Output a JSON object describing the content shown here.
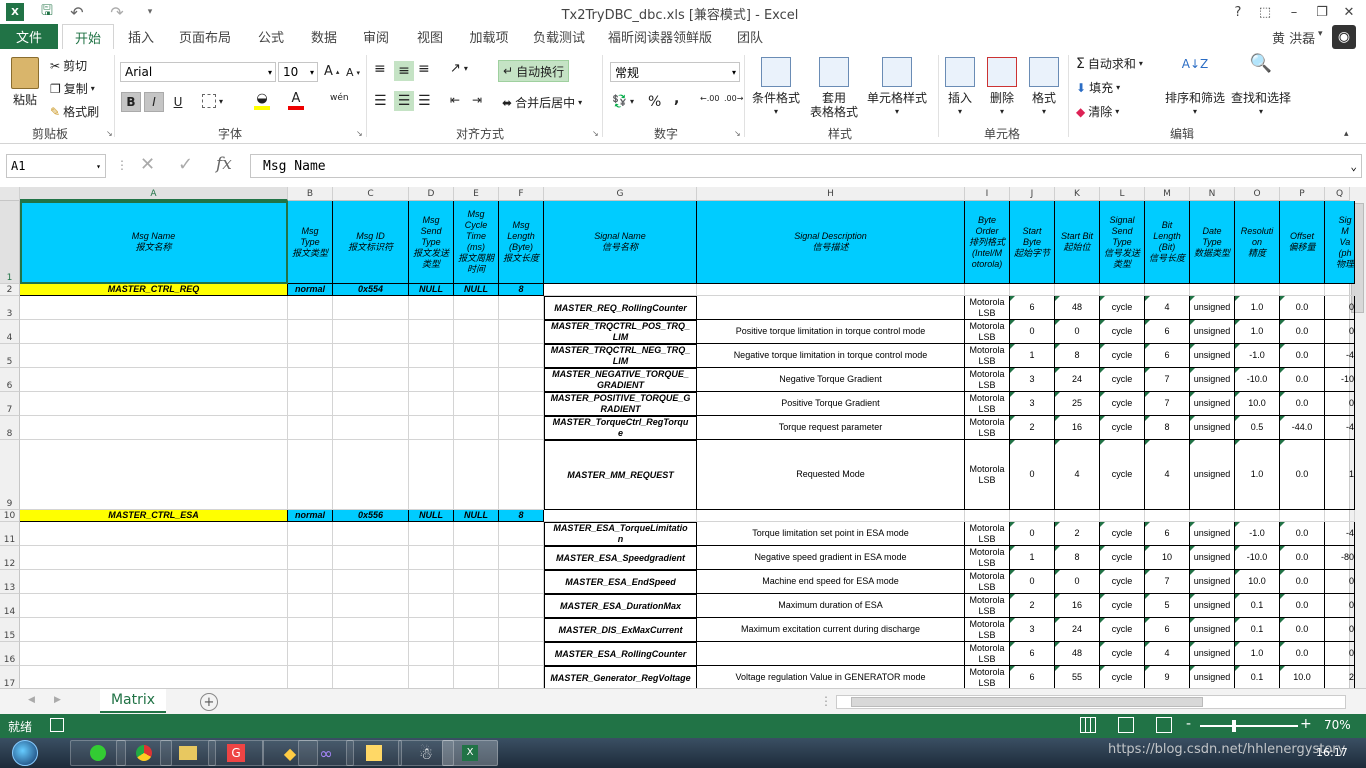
{
  "window": {
    "title": "Tx2TryDBC_dbc.xls  [兼容模式] - Excel",
    "help_label": "?",
    "user": "黄 洪磊"
  },
  "tabs": [
    "文件",
    "开始",
    "插入",
    "页面布局",
    "公式",
    "数据",
    "审阅",
    "视图",
    "加载项",
    "负载测试",
    "福昕阅读器领鲜版",
    "团队"
  ],
  "ribbon": {
    "clipboard": {
      "paste": "粘贴",
      "cut": "剪切",
      "copy": "复制",
      "format_painter": "格式刷",
      "label": "剪贴板"
    },
    "font": {
      "name": "Arial",
      "size": "10",
      "bold": "B",
      "italic": "I",
      "underline": "U",
      "wen": "wén",
      "label": "字体"
    },
    "alignment": {
      "wrap": "自动换行",
      "merge": "合并后居中",
      "label": "对齐方式"
    },
    "number": {
      "format": "常规",
      "percent": "%",
      "comma": ",",
      "label": "数字"
    },
    "styles": {
      "conditional": "条件格式",
      "table_format": "套用\n表格格式",
      "cell_styles": "单元格样式",
      "label": "样式"
    },
    "cells": {
      "insert": "插入",
      "delete": "删除",
      "format": "格式",
      "label": "单元格"
    },
    "editing": {
      "autosum": "自动求和",
      "fill": "填充",
      "clear": "清除",
      "sort": "排序和筛选",
      "find": "查找和选择",
      "label": "编辑"
    }
  },
  "formula_bar": {
    "name_box": "A1",
    "fx": "fx",
    "content": "Msg Name"
  },
  "columns": [
    "A",
    "B",
    "C",
    "D",
    "E",
    "F",
    "G",
    "H",
    "I",
    "J",
    "K",
    "L",
    "M",
    "N",
    "O",
    "P",
    "Q"
  ],
  "header_row": [
    "Msg Name\n报文名称",
    "Msg\nType\n报文类型",
    "Msg ID\n报文标识符",
    "Msg\nSend\nType\n报文发送\n类型",
    "Msg\nCycle\nTime\n(ms)\n报文周期\n时间",
    "Msg\nLength\n(Byte)\n报文长度",
    "Signal Name\n信号名称",
    "Signal Description\n信号描述",
    "Byte\nOrder\n排列格式\n(Intel/M\notorola)",
    "Start\nByte\n起始字节",
    "Start Bit\n起始位",
    "Signal\nSend\nType\n信号发送\n类型",
    "Bit\nLength\n(Bit)\n信号长度",
    "Date\nType\n数据类型",
    "Resoluti\non\n精度",
    "Offset\n偏移量",
    "Sig\nM\nVa\n(ph\n物理"
  ],
  "messages": [
    {
      "row": 2,
      "name": "MASTER_CTRL_REQ",
      "type": "normal",
      "id": "0x554",
      "send": "NULL",
      "cycle": "NULL",
      "len": "8"
    },
    {
      "row": 10,
      "name": "MASTER_CTRL_ESA",
      "type": "normal",
      "id": "0x556",
      "send": "NULL",
      "cycle": "NULL",
      "len": "8"
    }
  ],
  "signals": [
    {
      "row": 3,
      "name": "MASTER_REQ_RollingCounter",
      "desc": "",
      "order": "Motorola\nLSB",
      "sbyte": "6",
      "sbit": "48",
      "stype": "cycle",
      "blen": "4",
      "dtype": "unsigned",
      "res": "1.0",
      "off": "0.0",
      "q": "0"
    },
    {
      "row": 4,
      "name": "MASTER_TRQCTRL_POS_TRQ_\nLIM",
      "desc": "Positive torque limitation in torque control mode",
      "order": "Motorola\nLSB",
      "sbyte": "0",
      "sbit": "0",
      "stype": "cycle",
      "blen": "6",
      "dtype": "unsigned",
      "res": "1.0",
      "off": "0.0",
      "q": "0"
    },
    {
      "row": 5,
      "name": "MASTER_TRQCTRL_NEG_TRQ_\nLIM",
      "desc": "Negative torque limitation in torque control mode",
      "order": "Motorola\nLSB",
      "sbyte": "1",
      "sbit": "8",
      "stype": "cycle",
      "blen": "6",
      "dtype": "unsigned",
      "res": "-1.0",
      "off": "0.0",
      "q": "-4"
    },
    {
      "row": 6,
      "name": "MASTER_NEGATIVE_TORQUE_\nGRADIENT",
      "desc": "Negative Torque Gradient",
      "order": "Motorola\nLSB",
      "sbyte": "3",
      "sbit": "24",
      "stype": "cycle",
      "blen": "7",
      "dtype": "unsigned",
      "res": "-10.0",
      "off": "0.0",
      "q": "-10"
    },
    {
      "row": 7,
      "name": "MASTER_POSITIVE_TORQUE_G\nRADIENT",
      "desc": "Positive Torque Gradient",
      "order": "Motorola\nLSB",
      "sbyte": "3",
      "sbit": "25",
      "stype": "cycle",
      "blen": "7",
      "dtype": "unsigned",
      "res": "10.0",
      "off": "0.0",
      "q": "0"
    },
    {
      "row": 8,
      "name": "MASTER_TorqueCtrl_RegTorqu\ne",
      "desc": "Torque request parameter",
      "order": "Motorola\nLSB",
      "sbyte": "2",
      "sbit": "16",
      "stype": "cycle",
      "blen": "8",
      "dtype": "unsigned",
      "res": "0.5",
      "off": "-44.0",
      "q": "-4"
    },
    {
      "row": 9,
      "name": "MASTER_MM_REQUEST",
      "desc": "Requested Mode",
      "order": "Motorola\nLSB",
      "sbyte": "0",
      "sbit": "4",
      "stype": "cycle",
      "blen": "4",
      "dtype": "unsigned",
      "res": "1.0",
      "off": "0.0",
      "q": "1"
    },
    {
      "row": 11,
      "name": "MASTER_ESA_TorqueLimitatio\nn",
      "desc": "Torque limitation set point in ESA mode",
      "order": "Motorola\nLSB",
      "sbyte": "0",
      "sbit": "2",
      "stype": "cycle",
      "blen": "6",
      "dtype": "unsigned",
      "res": "-1.0",
      "off": "0.0",
      "q": "-4"
    },
    {
      "row": 12,
      "name": "MASTER_ESA_Speedgradient",
      "desc": "Negative speed gradient in ESA mode",
      "order": "Motorola\nLSB",
      "sbyte": "1",
      "sbit": "8",
      "stype": "cycle",
      "blen": "10",
      "dtype": "unsigned",
      "res": "-10.0",
      "off": "0.0",
      "q": "-80"
    },
    {
      "row": 13,
      "name": "MASTER_ESA_EndSpeed",
      "desc": "Machine end speed for ESA mode",
      "order": "Motorola\nLSB",
      "sbyte": "0",
      "sbit": "0",
      "stype": "cycle",
      "blen": "7",
      "dtype": "unsigned",
      "res": "10.0",
      "off": "0.0",
      "q": "0"
    },
    {
      "row": 14,
      "name": "MASTER_ESA_DurationMax",
      "desc": "Maximum duration of ESA",
      "order": "Motorola\nLSB",
      "sbyte": "2",
      "sbit": "16",
      "stype": "cycle",
      "blen": "5",
      "dtype": "unsigned",
      "res": "0.1",
      "off": "0.0",
      "q": "0"
    },
    {
      "row": 15,
      "name": "MASTER_DIS_ExMaxCurrent",
      "desc": "Maximum excitation current during discharge",
      "order": "Motorola\nLSB",
      "sbyte": "3",
      "sbit": "24",
      "stype": "cycle",
      "blen": "6",
      "dtype": "unsigned",
      "res": "0.1",
      "off": "0.0",
      "q": "0"
    },
    {
      "row": 16,
      "name": "MASTER_ESA_RollingCounter",
      "desc": "",
      "order": "Motorola\nLSB",
      "sbyte": "6",
      "sbit": "48",
      "stype": "cycle",
      "blen": "4",
      "dtype": "unsigned",
      "res": "1.0",
      "off": "0.0",
      "q": "0"
    },
    {
      "row": 17,
      "name": "MASTER_Generator_RegVoltage",
      "desc": "Voltage regulation Value in GENERATOR mode",
      "order": "Motorola\nLSB",
      "sbyte": "6",
      "sbit": "55",
      "stype": "cycle",
      "blen": "9",
      "dtype": "unsigned",
      "res": "0.1",
      "off": "10.0",
      "q": "2"
    }
  ],
  "sheet": {
    "name": "Matrix",
    "add": "+"
  },
  "status": {
    "ready": "就绪",
    "zoom": "70%",
    "minus": "-",
    "plus": "+"
  },
  "taskbar": {
    "clock": "16:17",
    "watermark": "https://blog.csdn.net/hhlenergystory"
  },
  "colors": {
    "excel_green": "#217346",
    "header_cyan": "#00ccff",
    "msg_yellow": "#ffff00"
  }
}
